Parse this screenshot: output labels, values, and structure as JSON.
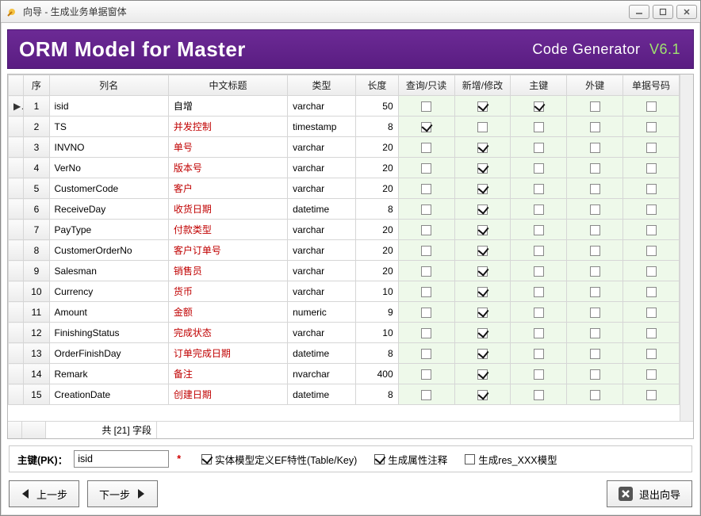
{
  "titlebar": {
    "title": "向导 - 生成业务单据窗体"
  },
  "header": {
    "title": "ORM Model for Master",
    "brand": "Code Generator",
    "version": "V6.1"
  },
  "columns": {
    "seq": "序",
    "name": "列名",
    "cn": "中文标题",
    "type": "类型",
    "len": "长度",
    "query": "查询/只读",
    "addmod": "新增/修改",
    "pk": "主键",
    "fk": "外键",
    "docno": "单据号码"
  },
  "rows": [
    {
      "seq": 1,
      "name": "isid",
      "cn": "自增",
      "cnRed": false,
      "type": "varchar",
      "len": 50,
      "query": false,
      "addmod": true,
      "pk": true,
      "fk": false,
      "docno": false,
      "marker": "▶"
    },
    {
      "seq": 2,
      "name": "TS",
      "cn": "并发控制",
      "cnRed": true,
      "type": "timestamp",
      "len": 8,
      "query": true,
      "addmod": false,
      "pk": false,
      "fk": false,
      "docno": false
    },
    {
      "seq": 3,
      "name": "INVNO",
      "cn": "单号",
      "cnRed": true,
      "type": "varchar",
      "len": 20,
      "query": false,
      "addmod": true,
      "pk": false,
      "fk": false,
      "docno": false
    },
    {
      "seq": 4,
      "name": "VerNo",
      "cn": "版本号",
      "cnRed": true,
      "type": "varchar",
      "len": 20,
      "query": false,
      "addmod": true,
      "pk": false,
      "fk": false,
      "docno": false
    },
    {
      "seq": 5,
      "name": "CustomerCode",
      "cn": "客户",
      "cnRed": true,
      "type": "varchar",
      "len": 20,
      "query": false,
      "addmod": true,
      "pk": false,
      "fk": false,
      "docno": false
    },
    {
      "seq": 6,
      "name": "ReceiveDay",
      "cn": "收货日期",
      "cnRed": true,
      "type": "datetime",
      "len": 8,
      "query": false,
      "addmod": true,
      "pk": false,
      "fk": false,
      "docno": false
    },
    {
      "seq": 7,
      "name": "PayType",
      "cn": "付款类型",
      "cnRed": true,
      "type": "varchar",
      "len": 20,
      "query": false,
      "addmod": true,
      "pk": false,
      "fk": false,
      "docno": false
    },
    {
      "seq": 8,
      "name": "CustomerOrderNo",
      "cn": "客户订单号",
      "cnRed": true,
      "type": "varchar",
      "len": 20,
      "query": false,
      "addmod": true,
      "pk": false,
      "fk": false,
      "docno": false
    },
    {
      "seq": 9,
      "name": "Salesman",
      "cn": "销售员",
      "cnRed": true,
      "type": "varchar",
      "len": 20,
      "query": false,
      "addmod": true,
      "pk": false,
      "fk": false,
      "docno": false
    },
    {
      "seq": 10,
      "name": "Currency",
      "cn": "货币",
      "cnRed": true,
      "type": "varchar",
      "len": 10,
      "query": false,
      "addmod": true,
      "pk": false,
      "fk": false,
      "docno": false
    },
    {
      "seq": 11,
      "name": "Amount",
      "cn": "金额",
      "cnRed": true,
      "type": "numeric",
      "len": 9,
      "query": false,
      "addmod": true,
      "pk": false,
      "fk": false,
      "docno": false
    },
    {
      "seq": 12,
      "name": "FinishingStatus",
      "cn": "完成状态",
      "cnRed": true,
      "type": "varchar",
      "len": 10,
      "query": false,
      "addmod": true,
      "pk": false,
      "fk": false,
      "docno": false
    },
    {
      "seq": 13,
      "name": "OrderFinishDay",
      "cn": "订单完成日期",
      "cnRed": true,
      "type": "datetime",
      "len": 8,
      "query": false,
      "addmod": true,
      "pk": false,
      "fk": false,
      "docno": false
    },
    {
      "seq": 14,
      "name": "Remark",
      "cn": "备注",
      "cnRed": true,
      "type": "nvarchar",
      "len": 400,
      "query": false,
      "addmod": true,
      "pk": false,
      "fk": false,
      "docno": false
    },
    {
      "seq": 15,
      "name": "CreationDate",
      "cn": "创建日期",
      "cnRed": true,
      "type": "datetime",
      "len": 8,
      "query": false,
      "addmod": true,
      "pk": false,
      "fk": false,
      "docno": false
    }
  ],
  "gridFooter": {
    "fieldCount": "共 [21] 字段"
  },
  "optbar": {
    "pkLabel": "主键(PK)：",
    "pkValue": "isid",
    "asterisk": "*",
    "opt1": {
      "label": "实体模型定义EF特性(Table/Key)",
      "checked": true
    },
    "opt2": {
      "label": "生成属性注释",
      "checked": true
    },
    "opt3": {
      "label": "生成res_XXX模型",
      "checked": false
    }
  },
  "nav": {
    "prev": "上一步",
    "next": "下一步",
    "exit": "退出向导"
  }
}
